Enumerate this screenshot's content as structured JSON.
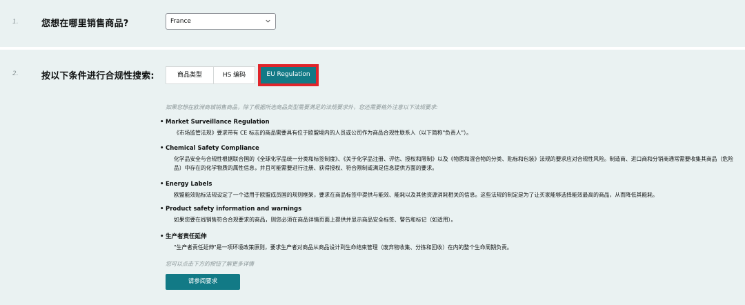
{
  "step1": {
    "number": "1.",
    "question": "您想在哪里销售商品?",
    "country_value": "France"
  },
  "step2": {
    "number": "2.",
    "question": "按以下条件进行合规性搜索:",
    "tabs": [
      {
        "label": "商品类型"
      },
      {
        "label": "HS 编码"
      },
      {
        "label": "EU Regulation"
      }
    ],
    "intro": "如果您想在欧洲商城销售商品，除了根据所选商品类型需要满足的法规要求外，您还需要格外注意以下法规要求:",
    "regulations": [
      {
        "title": "Market Surveillance Regulation",
        "desc": "《市场监管法规》要求带有 CE 标志的商品需要具有位于欧盟境内的人员或公司作为商品合规性联系人（以下简称\"负责人\"）。"
      },
      {
        "title": "Chemical Safety Compliance",
        "desc": "化学品安全与合规性根据联合国的《全球化学品统一分类和标签制度》、《关于化学品注册、评估、授权和限制》以及《物质和混合物的分类、贴标和包装》法规的要求应对合规性风险。制造商、进口商和分销商通常需要收集其商品（危险品）中存在的化学物质的属性信息，并且可能需要进行注册、获得授权、符合限制或满足信息提供方面的要求。"
      },
      {
        "title": "Energy Labels",
        "desc": "欧盟能效贴标法规设定了一个适用于欧盟成员国的规则框架，要求在商品标签中提供与能效、能耗以及其他资源消耗相关的信息。这些法规的制定是为了让买家能够选择能效最高的商品，从而降低其能耗。"
      },
      {
        "title": "Product safety information and warnings",
        "desc": "如果您要在线销售符合合规要求的商品，则您必须在商品详情页面上提供并显示商品安全标签、警告和标记（如适用）。"
      },
      {
        "title": "生产者责任延伸",
        "desc": "\"生产者责任延伸\"是一项环境政策原则，要求生产者对商品从商品设计到生命结束管理（废弃物收集、分拣和回收）在内的整个生命周期负责。"
      }
    ],
    "more_text": "您可以点击下方的按钮了解更多详情",
    "button_label": "请参阅要求"
  },
  "colors": {
    "background": "#eaf2f2",
    "accent": "#127a86",
    "highlight": "#e0252b"
  }
}
